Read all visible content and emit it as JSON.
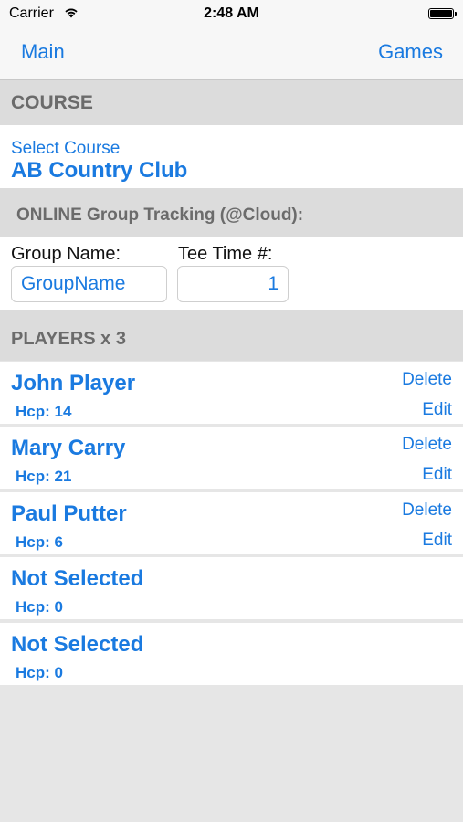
{
  "status_bar": {
    "carrier": "Carrier",
    "wifi_icon": "wifi-icon",
    "time": "2:48 AM",
    "battery_icon": "battery-icon"
  },
  "nav": {
    "left_label": "Main",
    "right_label": "Games"
  },
  "course_section": {
    "header": "COURSE",
    "select_label": "Select Course",
    "course_name": "AB Country Club"
  },
  "online_section": {
    "header": "ONLINE Group Tracking (@Cloud):",
    "group_name_label": "Group Name:",
    "group_name_placeholder": "GroupName",
    "tee_time_label": "Tee Time #:",
    "tee_time_value": "1"
  },
  "players_section": {
    "header": "PLAYERS x 3",
    "delete_label": "Delete",
    "edit_label": "Edit",
    "players": [
      {
        "name": "John Player",
        "hcp": "Hcp: 14"
      },
      {
        "name": "Mary Carry",
        "hcp": "Hcp: 21"
      },
      {
        "name": "Paul Putter",
        "hcp": "Hcp: 6"
      },
      {
        "name": "Not Selected",
        "hcp": "Hcp: 0"
      },
      {
        "name": "Not Selected",
        "hcp": "Hcp: 0"
      }
    ]
  },
  "colors": {
    "accent": "#1a7ae0",
    "section_header_bg": "#dcdcdc",
    "background": "#e6e6e6"
  }
}
